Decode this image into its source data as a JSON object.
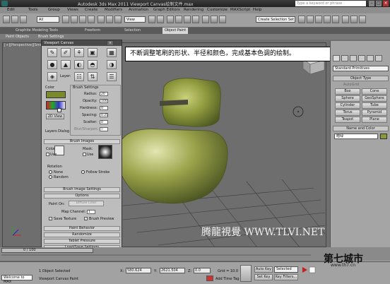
{
  "window": {
    "title": "Autodesk 3ds Max 2011    Viewport Canvas绘制文件.max",
    "search_placeholder": "Type a keyword or phrase"
  },
  "menu": [
    "Edit",
    "Tools",
    "Group",
    "Views",
    "Create",
    "Modifiers",
    "Animation",
    "Graph Editors",
    "Rendering",
    "Customize",
    "MAXScript",
    "Help"
  ],
  "toolbar": {
    "selection_filter": "All",
    "view_dropdown": "View",
    "named_selection": "Create Selection Set"
  },
  "ribbon": {
    "tabs": [
      "Graphite Modeling Tools",
      "Freeform",
      "Selection",
      "Object Paint"
    ],
    "active_tab": "Object Paint",
    "sub_items": [
      "Paint Objects",
      "Brush Settings"
    ]
  },
  "viewport": {
    "label": "[+][Perspective][Smooth + Highlights]",
    "note": "不断调整笔刷的形状、半径和颜色，完成基本色调的绘制。"
  },
  "canvas": {
    "title": "Viewport Canvas",
    "layer_label": "Layer:",
    "color_section": "Color",
    "btn_2dview": "2D View",
    "layers_dialog": "Layers Dialog",
    "brush_settings_title": "Brush Settings",
    "brush_params": [
      {
        "label": "Radius:",
        "value": "20"
      },
      {
        "label": "Opacity:",
        "value": "100"
      },
      {
        "label": "Hardness:",
        "value": "0"
      },
      {
        "label": "Spacing:",
        "value": "0.25"
      },
      {
        "label": "Scatter:",
        "value": "0"
      },
      {
        "label": "Blur/Sharpen:",
        "value": "0"
      }
    ],
    "brush_images": "Brush Images",
    "color_label": "Color:",
    "mask_label": "Mask:",
    "use_label": "Use",
    "rotation_label": "Rotation",
    "rot_none": "None",
    "rot_follow": "Follow Stroke",
    "rot_random": "Random",
    "brush_image_settings": "Brush Image Settings",
    "options": "Options",
    "paint_on_label": "Paint On:",
    "paint_on_value": "Diffuse Color",
    "map_channel_label": "Map Channel:",
    "map_channel_value": "1",
    "save_texture": "Save Texture",
    "brush_preview": "Brush Preview",
    "paint_behavior": "Paint Behavior",
    "randomize": "Randomize",
    "tablet_pressure": "Tablet Pressure",
    "load_save": "Load/Save Settings"
  },
  "command_panel": {
    "dropdown": "Standard Primitives",
    "object_type_header": "Object Type",
    "autogrid": "AutoGrid",
    "buttons": [
      "Box",
      "Cone",
      "Sphere",
      "GeoSphere",
      "Cylinder",
      "Tube",
      "Torus",
      "Pyramid",
      "Teapot",
      "Plane"
    ],
    "name_color_header": "Name and Color",
    "name_value": "暗绿"
  },
  "timeline": {
    "counter": "0 / 100"
  },
  "status": {
    "welcome": "Welcome to MAX",
    "objects_selected": "1 Object Selected",
    "prompt": "Viewport Canvas Paint",
    "x_label": "X:",
    "x_value": "580.624",
    "y_label": "Y:",
    "y_value": "2621.504",
    "z_label": "Z:",
    "z_value": "0.0",
    "grid": "Grid = 10.0",
    "auto_key": "Auto Key",
    "selected": "Selected",
    "set_key": "Set Key",
    "key_filters": "Key Filters...",
    "add_time_tag": "Add Time Tag"
  },
  "watermark": {
    "site": "腾龍視覺 WWW.TLVI.NET",
    "city": "第七城市",
    "city_url": "www.th7.cn"
  },
  "colors": {
    "accent_red": "#c02020",
    "ribbon_dark": "#5a5a5a",
    "viewport": "#6e6e6e",
    "object_green": "#8a9a3a"
  }
}
